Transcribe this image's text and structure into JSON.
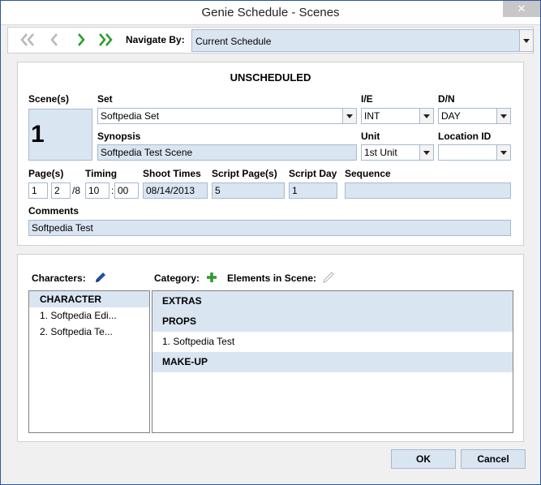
{
  "window": {
    "title": "Genie Schedule - Scenes",
    "close_glyph": "✕"
  },
  "nav": {
    "label": "Navigate By:",
    "value": "Current Schedule",
    "icons": [
      "first-record-icon",
      "previous-record-icon",
      "next-record-icon",
      "last-record-icon"
    ]
  },
  "scene": {
    "heading": "UNSCHEDULED",
    "labels": {
      "scenes": "Scene(s)",
      "set": "Set",
      "ie": "I/E",
      "dn": "D/N",
      "synopsis": "Synopsis",
      "unit": "Unit",
      "location_id": "Location ID",
      "pages": "Page(s)",
      "timing": "Timing",
      "shoot_times": "Shoot Times",
      "script_pages": "Script Page(s)",
      "script_day": "Script Day",
      "sequence": "Sequence",
      "comments": "Comments"
    },
    "number": "1",
    "set": "Softpedia Set",
    "ie": "INT",
    "dn": "DAY",
    "synopsis": "Softpedia Test Scene",
    "unit": "1st Unit",
    "location_id": "",
    "pages_whole": "1",
    "pages_num": "2",
    "pages_sep": "/8",
    "timing_min": "10",
    "timing_sep": ":",
    "timing_sec": "00",
    "shoot_date": "08/14/2013",
    "script_pages": "5",
    "script_day": "1",
    "sequence": "",
    "comments": "Softpedia Test"
  },
  "characters": {
    "header": "Characters:",
    "group": "CHARACTER",
    "items": [
      "1. Softpedia Edi...",
      "2. Softpedia Te..."
    ]
  },
  "elements": {
    "category_label": "Category:",
    "elements_label": "Elements in Scene:",
    "rows": [
      {
        "text": "EXTRAS",
        "group": true
      },
      {
        "text": "PROPS",
        "group": true
      },
      {
        "text": "1. Softpedia Test",
        "group": false
      },
      {
        "text": "MAKE-UP",
        "group": true
      }
    ]
  },
  "buttons": {
    "ok": "OK",
    "cancel": "Cancel"
  },
  "colors": {
    "field": "#dae5f2",
    "border": "#a7b9ce",
    "nav_green": "#2e9a2e",
    "nav_gray": "#b8b8b8",
    "pencil": "#1f4ea8"
  }
}
